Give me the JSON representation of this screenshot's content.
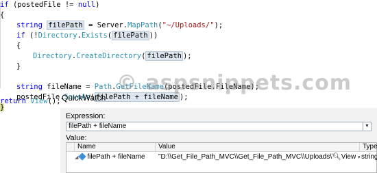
{
  "code": {
    "line1": {
      "kw": "if",
      "rest": " (postedFile != ",
      "null": "null",
      "close": ")"
    },
    "open_brace": "{",
    "line3": {
      "type": "string",
      "var": "filePath",
      "mid": " = Server.",
      "method": "MapPath",
      "paren": "(",
      "literal": "\"~/Uploads/\"",
      "end": ");"
    },
    "line4": {
      "kw": "if",
      "pre": " (!",
      "type": "Directory",
      "dot": ".",
      "method": "Exists",
      "open": "(",
      "var": "filePath",
      "end": "))"
    },
    "line5": "{",
    "line6": {
      "type": "Directory",
      "dot": ".",
      "method": "CreateDirectory",
      "open": "(",
      "var": "filePath",
      "end": ");"
    },
    "line7": "}",
    "line9": {
      "type": "string",
      "mid": " fileName = ",
      "type2": "Path",
      "dot": ".",
      "method": "GetFileName",
      "end": "(postedFile.FileName);"
    },
    "line10": {
      "pre": "postedFile.",
      "method": "SaveAs",
      "open": "(",
      "var": "filePath",
      "plus": " + fileName",
      "end": ");"
    },
    "close_brace": "}",
    "line13": {
      "kw": "return",
      "sp": " ",
      "method": "View",
      "end": "();"
    }
  },
  "watermark": "© aspsnippets.com",
  "quickwatch": {
    "title": "QuickWatch",
    "expression_label": "Expression:",
    "expression_value": "filePath + fileName",
    "value_label": "Value:",
    "columns": {
      "name": "Name",
      "value": "Value",
      "type": "Type"
    },
    "row": {
      "name": "filePath + fileName",
      "value": "\"D:\\\\Get_File_Path_MVC\\\\Get_File_Path_MVC\\\\Uploads\\\\Tulips.jpg\"",
      "view": "View",
      "type": "string"
    }
  },
  "icons": [
    "expand-arrow-icon",
    "property-icon",
    "magnifier-icon",
    "dropdown-arrow-icon"
  ]
}
